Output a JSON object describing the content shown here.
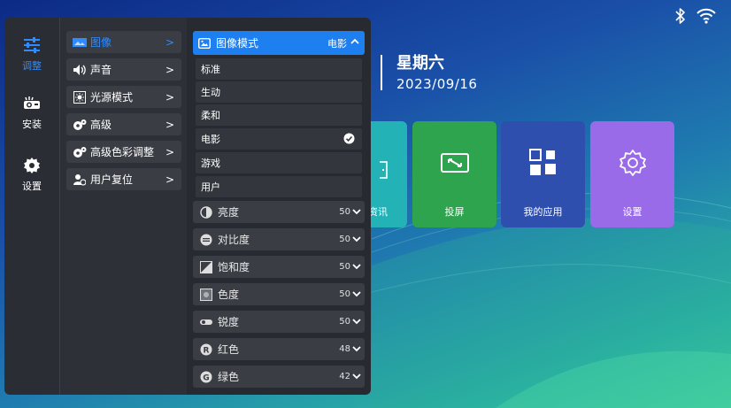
{
  "status": {
    "icons": [
      "bluetooth-icon",
      "wifi-icon"
    ]
  },
  "home": {
    "weekday": "星期六",
    "date": "2023/09/16",
    "tiles": [
      {
        "label": "资讯",
        "color": "#23b3b6"
      },
      {
        "label": "投屏",
        "color": "#2fa44f"
      },
      {
        "label": "我的应用",
        "color": "#2f4fae"
      },
      {
        "label": "设置",
        "color": "#9a6be8"
      }
    ]
  },
  "menu": {
    "nav": [
      {
        "label": "调整",
        "icon": "sliders-icon",
        "active": true
      },
      {
        "label": "安装",
        "icon": "projector-icon",
        "active": false
      },
      {
        "label": "设置",
        "icon": "gear-icon",
        "active": false
      }
    ],
    "sub": [
      {
        "label": "图像",
        "icon": "picture-icon",
        "active": true
      },
      {
        "label": "声音",
        "icon": "speaker-icon",
        "active": false
      },
      {
        "label": "光源模式",
        "icon": "light-source-icon",
        "active": false
      },
      {
        "label": "高级",
        "icon": "gears-icon",
        "active": false
      },
      {
        "label": "高级色彩调整",
        "icon": "color-gears-icon",
        "active": false
      },
      {
        "label": "用户复位",
        "icon": "user-reset-icon",
        "active": false
      }
    ],
    "chevron": ">",
    "picture_mode": {
      "title": "图像模式",
      "value": "电影",
      "options": [
        "标准",
        "生动",
        "柔和",
        "电影",
        "游戏",
        "用户"
      ],
      "selected": "电影"
    },
    "adjustments": [
      {
        "label": "亮度",
        "value": "50",
        "icon": "brightness-icon"
      },
      {
        "label": "对比度",
        "value": "50",
        "icon": "contrast-icon"
      },
      {
        "label": "饱和度",
        "value": "50",
        "icon": "saturation-icon"
      },
      {
        "label": "色度",
        "value": "50",
        "icon": "hue-icon"
      },
      {
        "label": "锐度",
        "value": "50",
        "icon": "sharpness-icon"
      },
      {
        "label": "红色",
        "value": "48",
        "icon": "red-channel-icon"
      },
      {
        "label": "绿色",
        "value": "42",
        "icon": "green-channel-icon"
      }
    ]
  },
  "colors": {
    "accent": "#1e7ff0",
    "active_text": "#2e8cff"
  }
}
